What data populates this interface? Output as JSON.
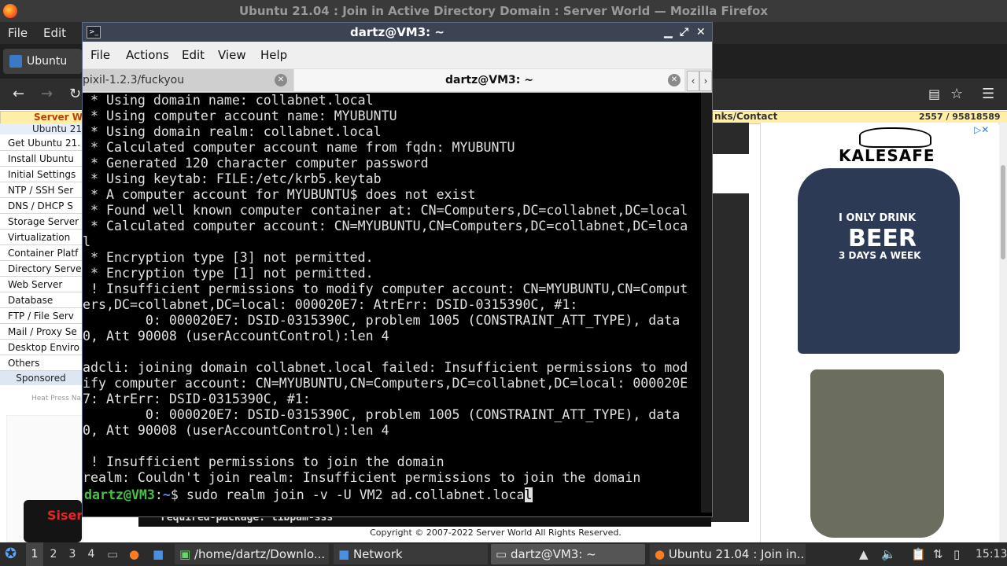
{
  "firefox": {
    "title": "Ubuntu 21.04 : Join in Active Directory Domain : Server World — Mozilla Firefox",
    "menu": [
      "File",
      "Edit"
    ],
    "tab_label": "Ubuntu 21"
  },
  "webpage": {
    "sidebar_header": "Server W",
    "sidebar_sub": "Ubuntu 21",
    "sidebar_items": [
      "Get Ubuntu 21.",
      "Install Ubuntu",
      "Initial Settings",
      "NTP / SSH Ser",
      "DNS / DHCP S",
      "Storage Server",
      "Virtualization",
      "Container Platf",
      "Directory Serve",
      "Web Server",
      "Database",
      "FTP / File Serv",
      "Mail / Proxy Se",
      "Desktop Enviro",
      "Others"
    ],
    "sponsored": "Sponsored",
    "heat_press": "Heat Press Na",
    "siser": "Siser",
    "links_contact": "nks/Contact",
    "counter": "2557 / 95818589",
    "ad_brand": "KALESAFE",
    "ad_shirt_line1": "I ONLY DRINK",
    "ad_shirt_line2": "BEER",
    "ad_shirt_line3": "3 DAYS A WEEK",
    "package_text": "required-package: libpam-sss",
    "copyright": "Copyright © 2007-2022 Server World All Rights Reserved."
  },
  "terminal": {
    "title": "dartz@VM3: ~",
    "menu": [
      "File",
      "Actions",
      "Edit",
      "View",
      "Help"
    ],
    "tabs": [
      {
        "label": "pixil-1.2.3/fuckyou",
        "active": false
      },
      {
        "label": "dartz@VM3: ~",
        "active": true
      }
    ],
    "lines": [
      " * Using domain name: collabnet.local",
      " * Using computer account name: MYUBUNTU",
      " * Using domain realm: collabnet.local",
      " * Calculated computer account name from fqdn: MYUBUNTU",
      " * Generated 120 character computer password",
      " * Using keytab: FILE:/etc/krb5.keytab",
      " * A computer account for MYUBUNTU$ does not exist",
      " * Found well known computer container at: CN=Computers,DC=collabnet,DC=local",
      " * Calculated computer account: CN=MYUBUNTU,CN=Computers,DC=collabnet,DC=loca",
      "l",
      " * Encryption type [3] not permitted.",
      " * Encryption type [1] not permitted.",
      " ! Insufficient permissions to modify computer account: CN=MYUBUNTU,CN=Comput",
      "ers,DC=collabnet,DC=local: 000020E7: AtrErr: DSID-0315390C, #1:",
      "        0: 000020E7: DSID-0315390C, problem 1005 (CONSTRAINT_ATT_TYPE), data",
      "0, Att 90008 (userAccountControl):len 4",
      "",
      "adcli: joining domain collabnet.local failed: Insufficient permissions to mod",
      "ify computer account: CN=MYUBUNTU,CN=Computers,DC=collabnet,DC=local: 000020E",
      "7: AtrErr: DSID-0315390C, #1:",
      "        0: 000020E7: DSID-0315390C, problem 1005 (CONSTRAINT_ATT_TYPE), data",
      "0, Att 90008 (userAccountControl):len 4",
      "",
      " ! Insufficient permissions to join the domain",
      "realm: Couldn't join realm: Insufficient permissions to join the domain"
    ],
    "prompt_user": "dartz@VM3",
    "prompt_sep": ":",
    "prompt_path": "~",
    "prompt_dollar": "$ ",
    "command": "sudo realm join -v -U VM2 ad.collabnet.loca",
    "cursor_char": "l"
  },
  "taskbar": {
    "workspaces": [
      "1",
      "2",
      "3",
      "4"
    ],
    "apps": [
      {
        "label": "/home/dartz/Downlo...",
        "icon": "image-viewer-icon"
      },
      {
        "label": "Network",
        "icon": "folder-icon"
      },
      {
        "label": "dartz@VM3: ~",
        "icon": "terminal-icon"
      },
      {
        "label": "Ubuntu 21.04 : Join in...",
        "icon": "firefox-icon"
      }
    ],
    "clock": "15:13"
  }
}
